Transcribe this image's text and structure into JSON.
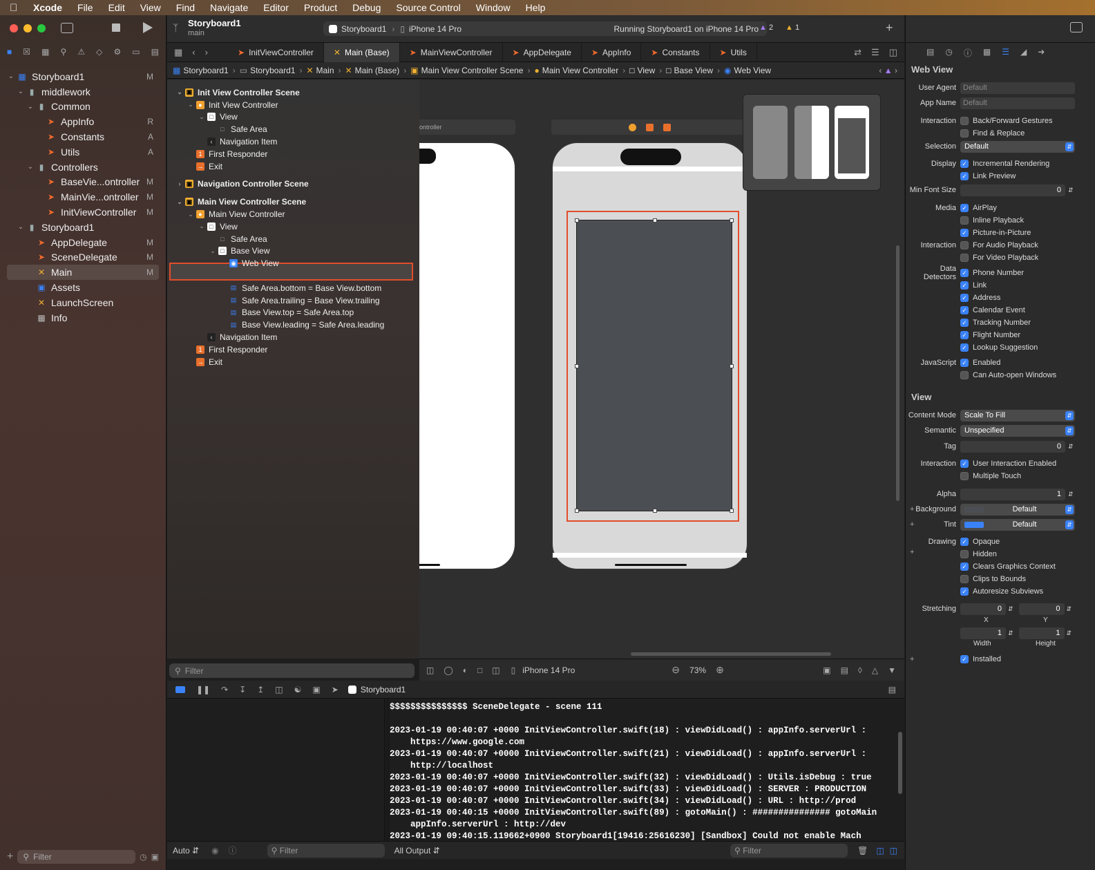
{
  "menubar": {
    "items": [
      "Xcode",
      "File",
      "Edit",
      "View",
      "Find",
      "Navigate",
      "Editor",
      "Product",
      "Debug",
      "Source Control",
      "Window",
      "Help"
    ]
  },
  "toolbar": {
    "project_title": "Storyboard1",
    "branch": "main",
    "scheme": "Storyboard1",
    "device": "iPhone 14 Pro",
    "status": "Running Storyboard1 on iPhone 14 Pro",
    "warnings": "2",
    "issues": "1"
  },
  "navigator": {
    "items": [
      {
        "label": "Storyboard1",
        "badge": "M",
        "level": 0,
        "type": "project",
        "chev": "v"
      },
      {
        "label": "middlework",
        "badge": "",
        "level": 1,
        "type": "folder",
        "chev": "v"
      },
      {
        "label": "Common",
        "badge": "",
        "level": 2,
        "type": "folder",
        "chev": "v"
      },
      {
        "label": "AppInfo",
        "badge": "R",
        "level": 3,
        "type": "swift",
        "chev": ""
      },
      {
        "label": "Constants",
        "badge": "A",
        "level": 3,
        "type": "swift",
        "chev": ""
      },
      {
        "label": "Utils",
        "badge": "A",
        "level": 3,
        "type": "swift",
        "chev": ""
      },
      {
        "label": "Controllers",
        "badge": "",
        "level": 2,
        "type": "folder",
        "chev": "v"
      },
      {
        "label": "BaseVie...ontroller",
        "badge": "M",
        "level": 3,
        "type": "swift",
        "chev": ""
      },
      {
        "label": "MainVie...ontroller",
        "badge": "M",
        "level": 3,
        "type": "swift",
        "chev": ""
      },
      {
        "label": "InitViewController",
        "badge": "M",
        "level": 3,
        "type": "swift",
        "chev": ""
      },
      {
        "label": "Storyboard1",
        "badge": "",
        "level": 1,
        "type": "folder",
        "chev": "v"
      },
      {
        "label": "AppDelegate",
        "badge": "M",
        "level": 2,
        "type": "swift",
        "chev": ""
      },
      {
        "label": "SceneDelegate",
        "badge": "M",
        "level": 2,
        "type": "swift",
        "chev": ""
      },
      {
        "label": "Main",
        "badge": "M",
        "level": 2,
        "type": "xib",
        "chev": "",
        "selected": true
      },
      {
        "label": "Assets",
        "badge": "",
        "level": 2,
        "type": "assets",
        "chev": ""
      },
      {
        "label": "LaunchScreen",
        "badge": "",
        "level": 2,
        "type": "xib",
        "chev": ""
      },
      {
        "label": "Info",
        "badge": "",
        "level": 2,
        "type": "plist",
        "chev": ""
      }
    ],
    "filter_placeholder": "Filter"
  },
  "tabs": [
    "InitViewController",
    "Main (Base)",
    "MainViewController",
    "AppDelegate",
    "AppInfo",
    "Constants",
    "Utils"
  ],
  "jumpbar": [
    "Storyboard1",
    "Storyboard1",
    "Main",
    "Main (Base)",
    "Main View Controller Scene",
    "Main View Controller",
    "View",
    "Base View",
    "Web View"
  ],
  "outline": {
    "items": [
      {
        "label": "Init View Controller Scene",
        "level": 0,
        "icon": "scene",
        "chev": "v",
        "bold": true
      },
      {
        "label": "Init View Controller",
        "level": 1,
        "icon": "vc",
        "chev": "v"
      },
      {
        "label": "View",
        "level": 2,
        "icon": "view",
        "chev": "v"
      },
      {
        "label": "Safe Area",
        "level": 3,
        "icon": "safe",
        "chev": ""
      },
      {
        "label": "Navigation Item",
        "level": 2,
        "icon": "navitem",
        "chev": ""
      },
      {
        "label": "First Responder",
        "level": 1,
        "icon": "fr",
        "chev": ""
      },
      {
        "label": "Exit",
        "level": 1,
        "icon": "exit",
        "chev": ""
      },
      {
        "label": "",
        "level": 0,
        "icon": "",
        "chev": "",
        "spacer": true
      },
      {
        "label": "Navigation Controller Scene",
        "level": 0,
        "icon": "scene",
        "chev": ">",
        "bold": true
      },
      {
        "label": "",
        "level": 0,
        "icon": "",
        "chev": "",
        "spacer": true
      },
      {
        "label": "Main View Controller Scene",
        "level": 0,
        "icon": "scene",
        "chev": "v",
        "bold": true
      },
      {
        "label": "Main View Controller",
        "level": 1,
        "icon": "vc",
        "chev": "v"
      },
      {
        "label": "View",
        "level": 2,
        "icon": "view",
        "chev": "v"
      },
      {
        "label": "Safe Area",
        "level": 3,
        "icon": "safe",
        "chev": ""
      },
      {
        "label": "Base View",
        "level": 3,
        "icon": "view",
        "chev": "v"
      },
      {
        "label": "Web View",
        "level": 4,
        "icon": "web",
        "chev": "",
        "selected": true
      },
      {
        "label": "Constraints",
        "level": 3,
        "icon": "cons",
        "chev": "v"
      },
      {
        "label": "Safe Area.bottom = Base View.bottom",
        "level": 4,
        "icon": "cons",
        "chev": ""
      },
      {
        "label": "Safe Area.trailing = Base View.trailing",
        "level": 4,
        "icon": "cons",
        "chev": ""
      },
      {
        "label": "Base View.top = Safe Area.top",
        "level": 4,
        "icon": "cons",
        "chev": ""
      },
      {
        "label": "Base View.leading = Safe Area.leading",
        "level": 4,
        "icon": "cons",
        "chev": ""
      },
      {
        "label": "Navigation Item",
        "level": 2,
        "icon": "navitem",
        "chev": ""
      },
      {
        "label": "First Responder",
        "level": 1,
        "icon": "fr",
        "chev": ""
      },
      {
        "label": "Exit",
        "level": 1,
        "icon": "exit",
        "chev": ""
      }
    ],
    "filter_placeholder": "Filter"
  },
  "canvas": {
    "left_label": "ontroller",
    "device": "iPhone 14 Pro",
    "zoom": "73%"
  },
  "debug": {
    "target": "Storyboard1",
    "output_filter": "All Output",
    "auto": "Auto",
    "filter_placeholder": "Filter"
  },
  "console_lines": [
    "$$$$$$$$$$$$$$$ SceneDelegate - scene 111",
    "",
    "2023-01-19 00:40:07 +0000 InitViewController.swift(18) : viewDidLoad() : appInfo.serverUrl :",
    "    https://www.google.com",
    "2023-01-19 00:40:07 +0000 InitViewController.swift(21) : viewDidLoad() : appInfo.serverUrl :",
    "    http://localhost",
    "2023-01-19 00:40:07 +0000 InitViewController.swift(32) : viewDidLoad() : Utils.isDebug : true",
    "2023-01-19 00:40:07 +0000 InitViewController.swift(33) : viewDidLoad() : SERVER : PRODUCTION",
    "2023-01-19 00:40:07 +0000 InitViewController.swift(34) : viewDidLoad() : URL : http://prod",
    "2023-01-19 00:40:15 +0000 InitViewController.swift(89) : gotoMain() : ############### gotoMain",
    "    appInfo.serverUrl : http://dev",
    "2023-01-19 09:40:15.119662+0900 Storyboard1[19416:25616230] [Sandbox] Could not enable Mach"
  ],
  "inspector": {
    "section_web": "Web View",
    "user_agent_label": "User Agent",
    "user_agent_ph": "Default",
    "app_name_label": "App Name",
    "app_name_ph": "Default",
    "section_view": "View",
    "rows": [
      {
        "label": "Interaction",
        "text": "Back/Forward Gestures",
        "on": false
      },
      {
        "label": "",
        "text": "Find & Replace",
        "on": false
      },
      {
        "label": "Display",
        "text": "Incremental Rendering",
        "on": true
      },
      {
        "label": "",
        "text": "Link Preview",
        "on": true
      },
      {
        "label": "Media",
        "text": "AirPlay",
        "on": true
      },
      {
        "label": "",
        "text": "Inline Playback",
        "on": false
      },
      {
        "label": "",
        "text": "Picture-in-Picture",
        "on": true
      },
      {
        "label": "Interaction",
        "text": "For Audio Playback",
        "on": false
      },
      {
        "label": "",
        "text": "For Video Playback",
        "on": false
      },
      {
        "label": "Data Detectors",
        "text": "Phone Number",
        "on": true
      },
      {
        "label": "",
        "text": "Link",
        "on": true
      },
      {
        "label": "",
        "text": "Address",
        "on": true
      },
      {
        "label": "",
        "text": "Calendar Event",
        "on": true
      },
      {
        "label": "",
        "text": "Tracking Number",
        "on": true
      },
      {
        "label": "",
        "text": "Flight Number",
        "on": true
      },
      {
        "label": "",
        "text": "Lookup Suggestion",
        "on": true
      },
      {
        "label": "JavaScript",
        "text": "Enabled",
        "on": true
      },
      {
        "label": "",
        "text": "Can Auto-open Windows",
        "on": false
      }
    ],
    "selection_label": "Selection",
    "selection_value": "Default",
    "minfont_label": "Min Font Size",
    "minfont_value": "0",
    "content_mode_label": "Content Mode",
    "content_mode_value": "Scale To Fill",
    "semantic_label": "Semantic",
    "semantic_value": "Unspecified",
    "tag_label": "Tag",
    "tag_value": "0",
    "view_rows": [
      {
        "label": "Interaction",
        "text": "User Interaction Enabled",
        "on": true
      },
      {
        "label": "",
        "text": "Multiple Touch",
        "on": false
      }
    ],
    "alpha_label": "Alpha",
    "alpha_value": "1",
    "bg_label": "Background",
    "bg_value": "Default",
    "tint_label": "Tint",
    "tint_value": "Default",
    "drawing_rows": [
      {
        "label": "Drawing",
        "text": "Opaque",
        "on": true
      },
      {
        "label": "",
        "text": "Hidden",
        "on": false
      },
      {
        "label": "",
        "text": "Clears Graphics Context",
        "on": true
      },
      {
        "label": "",
        "text": "Clips to Bounds",
        "on": false
      },
      {
        "label": "",
        "text": "Autoresize Subviews",
        "on": true
      }
    ],
    "stretching_label": "Stretching",
    "stretch_x": "0",
    "stretch_y": "0",
    "x_label": "X",
    "y_label": "Y",
    "width_value": "1",
    "height_value": "1",
    "width_label": "Width",
    "height_label": "Height",
    "installed_label": "Installed"
  },
  "colors": {
    "accent": "#3a82f7",
    "selection_outline": "#e24d2a"
  }
}
